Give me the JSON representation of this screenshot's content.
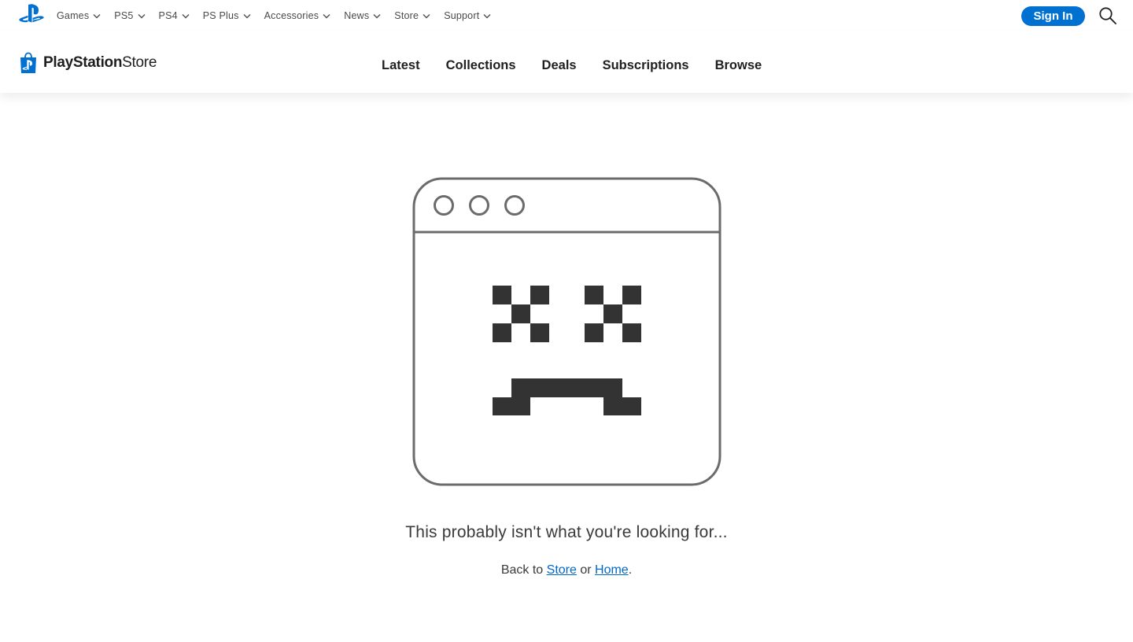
{
  "global_nav": {
    "logo_icon": "playstation-logo-icon",
    "links": [
      {
        "label": "Games"
      },
      {
        "label": "PS5"
      },
      {
        "label": "PS4"
      },
      {
        "label": "PS Plus"
      },
      {
        "label": "Accessories"
      },
      {
        "label": "News"
      },
      {
        "label": "Store"
      },
      {
        "label": "Support"
      }
    ],
    "sign_in_label": "Sign In",
    "search_icon": "search-icon"
  },
  "store_header": {
    "brand_bold": "PlayStation",
    "brand_light": "Store",
    "nav": [
      {
        "label": "Latest"
      },
      {
        "label": "Collections"
      },
      {
        "label": "Deals"
      },
      {
        "label": "Subscriptions"
      },
      {
        "label": "Browse"
      }
    ]
  },
  "error": {
    "illustration_icon": "sad-browser-window-icon",
    "message": "This probably isn't what you're looking for...",
    "back_prefix": "Back to ",
    "store_link": "Store",
    "separator": " or ",
    "home_link": "Home",
    "suffix": "."
  },
  "colors": {
    "accent": "#0070d1",
    "link": "#0068c8",
    "illustration_stroke": "#6b6b6b",
    "illustration_fill": "#333333"
  }
}
